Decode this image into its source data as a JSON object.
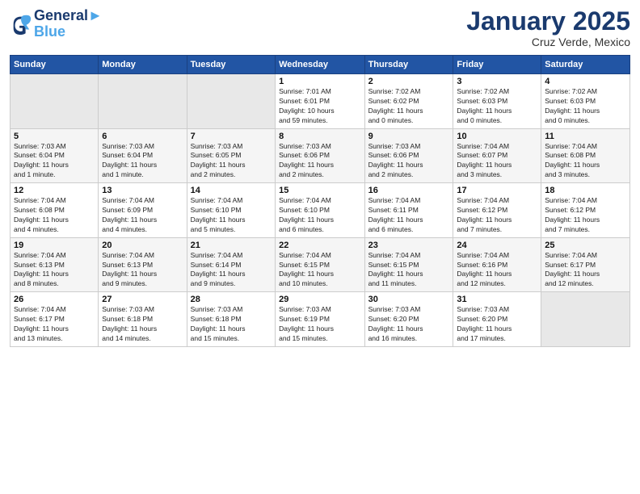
{
  "header": {
    "logo_line1": "General",
    "logo_line2": "Blue",
    "month": "January 2025",
    "location": "Cruz Verde, Mexico"
  },
  "weekdays": [
    "Sunday",
    "Monday",
    "Tuesday",
    "Wednesday",
    "Thursday",
    "Friday",
    "Saturday"
  ],
  "weeks": [
    [
      {
        "day": "",
        "info": ""
      },
      {
        "day": "",
        "info": ""
      },
      {
        "day": "",
        "info": ""
      },
      {
        "day": "1",
        "info": "Sunrise: 7:01 AM\nSunset: 6:01 PM\nDaylight: 10 hours\nand 59 minutes."
      },
      {
        "day": "2",
        "info": "Sunrise: 7:02 AM\nSunset: 6:02 PM\nDaylight: 11 hours\nand 0 minutes."
      },
      {
        "day": "3",
        "info": "Sunrise: 7:02 AM\nSunset: 6:03 PM\nDaylight: 11 hours\nand 0 minutes."
      },
      {
        "day": "4",
        "info": "Sunrise: 7:02 AM\nSunset: 6:03 PM\nDaylight: 11 hours\nand 0 minutes."
      }
    ],
    [
      {
        "day": "5",
        "info": "Sunrise: 7:03 AM\nSunset: 6:04 PM\nDaylight: 11 hours\nand 1 minute."
      },
      {
        "day": "6",
        "info": "Sunrise: 7:03 AM\nSunset: 6:04 PM\nDaylight: 11 hours\nand 1 minute."
      },
      {
        "day": "7",
        "info": "Sunrise: 7:03 AM\nSunset: 6:05 PM\nDaylight: 11 hours\nand 2 minutes."
      },
      {
        "day": "8",
        "info": "Sunrise: 7:03 AM\nSunset: 6:06 PM\nDaylight: 11 hours\nand 2 minutes."
      },
      {
        "day": "9",
        "info": "Sunrise: 7:03 AM\nSunset: 6:06 PM\nDaylight: 11 hours\nand 2 minutes."
      },
      {
        "day": "10",
        "info": "Sunrise: 7:04 AM\nSunset: 6:07 PM\nDaylight: 11 hours\nand 3 minutes."
      },
      {
        "day": "11",
        "info": "Sunrise: 7:04 AM\nSunset: 6:08 PM\nDaylight: 11 hours\nand 3 minutes."
      }
    ],
    [
      {
        "day": "12",
        "info": "Sunrise: 7:04 AM\nSunset: 6:08 PM\nDaylight: 11 hours\nand 4 minutes."
      },
      {
        "day": "13",
        "info": "Sunrise: 7:04 AM\nSunset: 6:09 PM\nDaylight: 11 hours\nand 4 minutes."
      },
      {
        "day": "14",
        "info": "Sunrise: 7:04 AM\nSunset: 6:10 PM\nDaylight: 11 hours\nand 5 minutes."
      },
      {
        "day": "15",
        "info": "Sunrise: 7:04 AM\nSunset: 6:10 PM\nDaylight: 11 hours\nand 6 minutes."
      },
      {
        "day": "16",
        "info": "Sunrise: 7:04 AM\nSunset: 6:11 PM\nDaylight: 11 hours\nand 6 minutes."
      },
      {
        "day": "17",
        "info": "Sunrise: 7:04 AM\nSunset: 6:12 PM\nDaylight: 11 hours\nand 7 minutes."
      },
      {
        "day": "18",
        "info": "Sunrise: 7:04 AM\nSunset: 6:12 PM\nDaylight: 11 hours\nand 7 minutes."
      }
    ],
    [
      {
        "day": "19",
        "info": "Sunrise: 7:04 AM\nSunset: 6:13 PM\nDaylight: 11 hours\nand 8 minutes."
      },
      {
        "day": "20",
        "info": "Sunrise: 7:04 AM\nSunset: 6:13 PM\nDaylight: 11 hours\nand 9 minutes."
      },
      {
        "day": "21",
        "info": "Sunrise: 7:04 AM\nSunset: 6:14 PM\nDaylight: 11 hours\nand 9 minutes."
      },
      {
        "day": "22",
        "info": "Sunrise: 7:04 AM\nSunset: 6:15 PM\nDaylight: 11 hours\nand 10 minutes."
      },
      {
        "day": "23",
        "info": "Sunrise: 7:04 AM\nSunset: 6:15 PM\nDaylight: 11 hours\nand 11 minutes."
      },
      {
        "day": "24",
        "info": "Sunrise: 7:04 AM\nSunset: 6:16 PM\nDaylight: 11 hours\nand 12 minutes."
      },
      {
        "day": "25",
        "info": "Sunrise: 7:04 AM\nSunset: 6:17 PM\nDaylight: 11 hours\nand 12 minutes."
      }
    ],
    [
      {
        "day": "26",
        "info": "Sunrise: 7:04 AM\nSunset: 6:17 PM\nDaylight: 11 hours\nand 13 minutes."
      },
      {
        "day": "27",
        "info": "Sunrise: 7:03 AM\nSunset: 6:18 PM\nDaylight: 11 hours\nand 14 minutes."
      },
      {
        "day": "28",
        "info": "Sunrise: 7:03 AM\nSunset: 6:18 PM\nDaylight: 11 hours\nand 15 minutes."
      },
      {
        "day": "29",
        "info": "Sunrise: 7:03 AM\nSunset: 6:19 PM\nDaylight: 11 hours\nand 15 minutes."
      },
      {
        "day": "30",
        "info": "Sunrise: 7:03 AM\nSunset: 6:20 PM\nDaylight: 11 hours\nand 16 minutes."
      },
      {
        "day": "31",
        "info": "Sunrise: 7:03 AM\nSunset: 6:20 PM\nDaylight: 11 hours\nand 17 minutes."
      },
      {
        "day": "",
        "info": ""
      }
    ]
  ]
}
